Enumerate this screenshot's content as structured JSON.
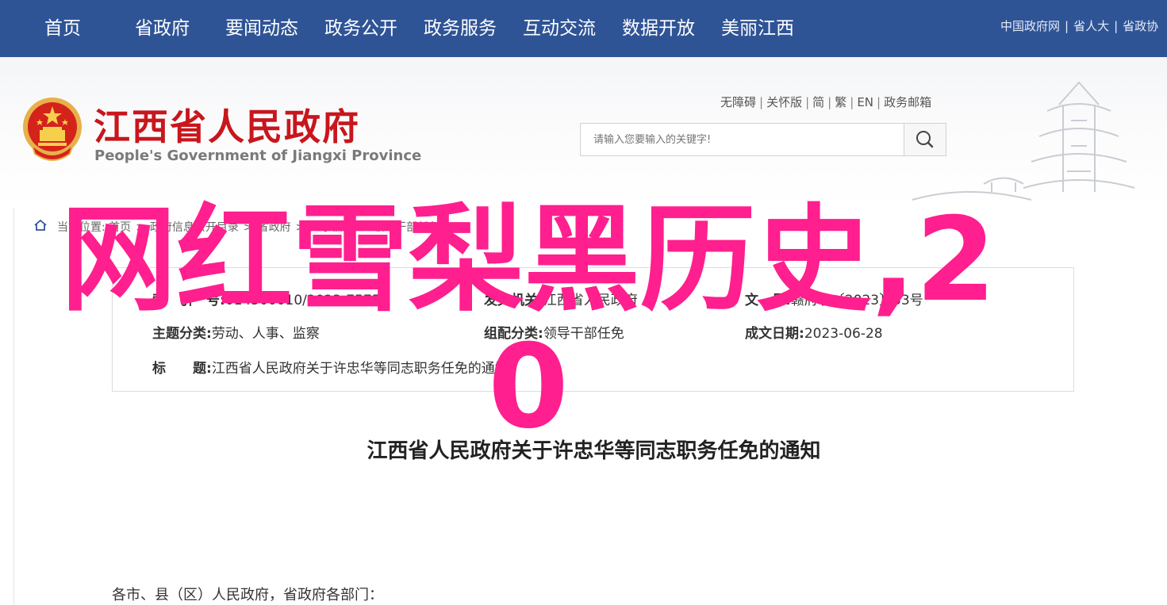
{
  "nav": {
    "items": [
      "首页",
      "省政府",
      "要闻动态",
      "政务公开",
      "政务服务",
      "互动交流",
      "数据开放",
      "美丽江西"
    ],
    "top_links": [
      "中国政府网",
      "省人大",
      "省政协"
    ]
  },
  "header": {
    "site_title": "江西省人民政府",
    "site_subtitle": "People's Government of Jiangxi Province",
    "access_links": [
      "无障碍",
      "关怀版",
      "简",
      "繁",
      "EN",
      "政务邮箱"
    ],
    "search_placeholder": "请输入您要输入的关键字!"
  },
  "breadcrumb": {
    "label": "当前位置:",
    "items": [
      "首页",
      "政府信息公开目录",
      "省政府",
      "人事信息",
      "领导干部任免"
    ]
  },
  "meta": {
    "index_label": "索　引　号:",
    "index_value": "014500010/2023-75752",
    "issuer_label": "发文机关:",
    "issuer_value": "江西省人民政府",
    "doc_no_label": "文　号:",
    "doc_no_value": "赣府字〔2023〕33号",
    "topic_label": "主题分类:",
    "topic_value": "劳动、人事、监察",
    "group_label": "组配分类:",
    "group_value": "领导干部任免",
    "date_label": "成文日期:",
    "date_value": "2023-06-28",
    "title_label": "标　　题:",
    "title_value": "江西省人民政府关于许忠华等同志职务任免的通知"
  },
  "doc": {
    "title": "江西省人民政府关于许忠华等同志职务任免的通知",
    "body_first_line": "各市、县（区）人民政府，省政府各部门："
  },
  "overlay_text": "网红雪梨黑历史,20",
  "colors": {
    "nav_bg": "#2f5496",
    "title_red": "#c8161d",
    "overlay_pink": "#ff1f8e"
  },
  "icons": {
    "search": "search-icon",
    "home": "home-icon",
    "emblem": "national-emblem-icon"
  }
}
